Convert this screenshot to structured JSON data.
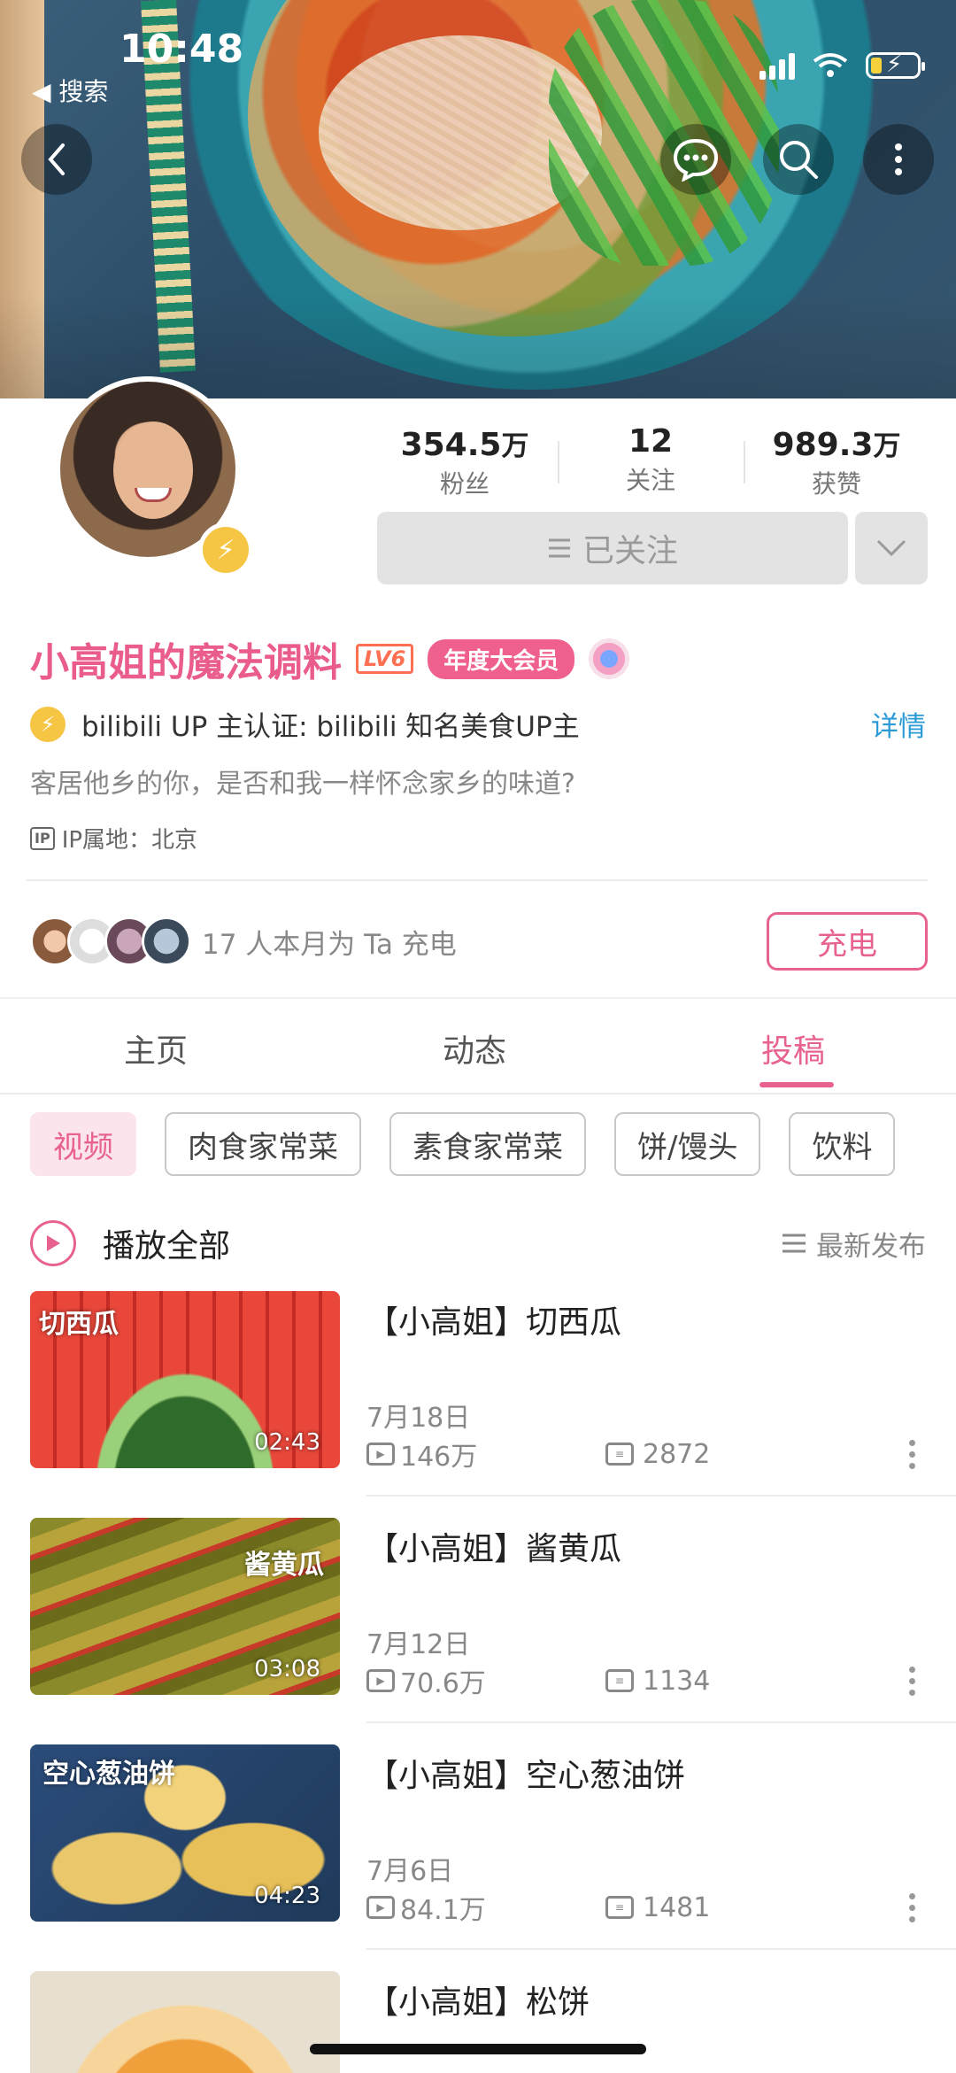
{
  "status_bar": {
    "time": "10:48",
    "back_app": "◀ 搜索"
  },
  "profile": {
    "stats": [
      {
        "value": "354.5",
        "unit": "万",
        "label": "粉丝"
      },
      {
        "value": "12",
        "unit": "",
        "label": "关注"
      },
      {
        "value": "989.3",
        "unit": "万",
        "label": "获赞"
      }
    ],
    "follow_label": "已关注",
    "name": "小高姐的魔法调料",
    "level": "LV6",
    "vip_badge": "年度大会员",
    "verify_text": "bilibili UP 主认证: bilibili 知名美食UP主",
    "verify_detail": "详情",
    "signature": "客居他乡的你，是否和我一样怀念家乡的味道?",
    "ip_label": "IP属地：北京",
    "charge_text": "17 人本月为 Ta 充电",
    "charge_button": "充电"
  },
  "tabs": [
    {
      "label": "主页",
      "active": false
    },
    {
      "label": "动态",
      "active": false
    },
    {
      "label": "投稿",
      "active": true
    }
  ],
  "chips": [
    "视频",
    "肉食家常菜",
    "素食家常菜",
    "饼/馒头",
    "饮料"
  ],
  "play_all": {
    "label": "播放全部",
    "sort": "最新发布"
  },
  "videos": [
    {
      "title": "【小高姐】切西瓜",
      "thumb_text": "切西瓜",
      "duration": "02:43",
      "date": "7月18日",
      "plays": "146万",
      "comments": "2872"
    },
    {
      "title": "【小高姐】酱黄瓜",
      "thumb_text": "酱黄瓜",
      "duration": "03:08",
      "date": "7月12日",
      "plays": "70.6万",
      "comments": "1134"
    },
    {
      "title": "【小高姐】空心葱油饼",
      "thumb_text": "空心葱油饼",
      "duration": "04:23",
      "date": "7月6日",
      "plays": "84.1万",
      "comments": "1481"
    },
    {
      "title": "【小高姐】松饼"
    }
  ],
  "colors": {
    "accent": "#e8628f",
    "link": "#2a9bd6",
    "badge": "#f6c544"
  }
}
